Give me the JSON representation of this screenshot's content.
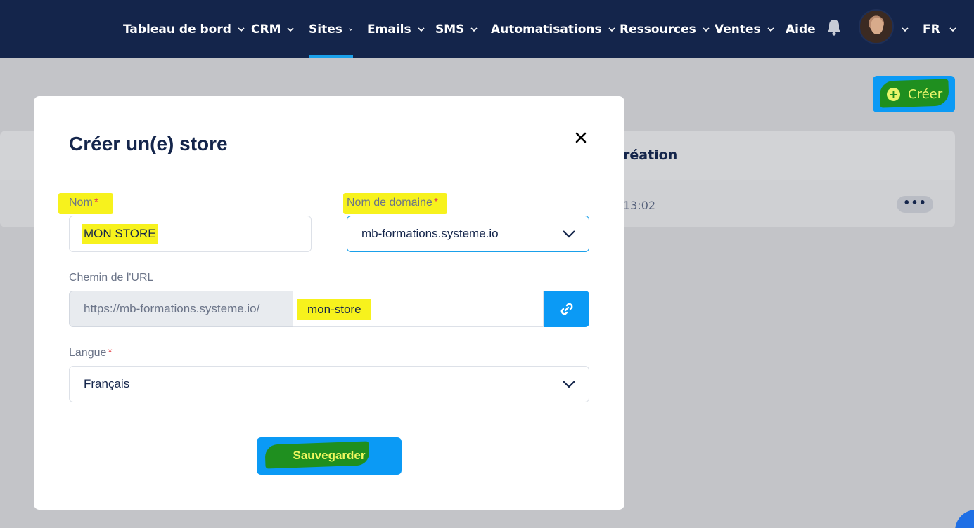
{
  "nav": {
    "items": [
      {
        "label": "Tableau de bord",
        "has_dropdown": true,
        "active": false
      },
      {
        "label": "CRM",
        "has_dropdown": true,
        "active": false
      },
      {
        "label": "Sites",
        "has_dropdown": true,
        "active": true
      },
      {
        "label": "Emails",
        "has_dropdown": true,
        "active": false
      },
      {
        "label": "SMS",
        "has_dropdown": true,
        "active": false
      },
      {
        "label": "Automatisations",
        "has_dropdown": true,
        "active": false
      },
      {
        "label": "Ressources",
        "has_dropdown": true,
        "active": false
      },
      {
        "label": "Ventes",
        "has_dropdown": true,
        "active": false
      },
      {
        "label": "Aide",
        "has_dropdown": false,
        "active": false
      }
    ],
    "bell_icon": "bell-icon",
    "avatar_icon": "user-avatar",
    "language": "FR"
  },
  "page": {
    "create_button_label": "Créer",
    "create_button_icon": "plus-circle-icon",
    "table_header_partial": "réation",
    "row_time_partial": "13:02",
    "row_menu_label": "•••"
  },
  "modal": {
    "title": "Créer un(e) store",
    "close_icon": "close-icon",
    "fields": {
      "name": {
        "label": "Nom",
        "required": "*",
        "value": "MON STORE"
      },
      "domain": {
        "label": "Nom de domaine",
        "required": "*",
        "value": "mb-formations.systeme.io"
      },
      "url_path": {
        "label": "Chemin de l'URL",
        "prefix": "https://mb-formations.systeme.io/",
        "value": "mon-store",
        "link_icon": "link-icon"
      },
      "language": {
        "label": "Langue",
        "required": "*",
        "value": "Français"
      }
    },
    "save_button_label": "Sauvegarder"
  },
  "colors": {
    "navbar": "#14254b",
    "accent": "#0b9af5",
    "active_tab_underline": "#1aa0ea",
    "highlight_yellow": "#f7f21d",
    "highlight_green": "#1f8f1f",
    "required": "#e5484d"
  }
}
